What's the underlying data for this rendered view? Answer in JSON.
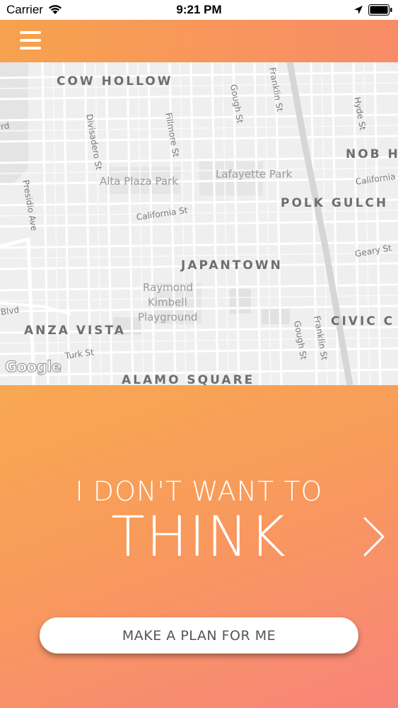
{
  "status_bar": {
    "carrier": "Carrier",
    "time": "9:21 PM"
  },
  "header": {
    "menu_icon": "hamburger-menu-icon"
  },
  "map": {
    "districts": [
      "COW HOLLOW",
      "NOB H",
      "POLK GULCH",
      "JAPANTOWN",
      "ANZA VISTA",
      "CIVIC C",
      "ALAMO SQUARE"
    ],
    "parks": [
      "Alta Plaza Park",
      "Lafayette Park",
      "Raymond",
      "Kimbell",
      "Playground"
    ],
    "streets": [
      "Gough St",
      "Franklin St",
      "Hyde St",
      "Divisadero St",
      "Fillmore St",
      "Presidio Ave",
      "California St",
      "California St",
      "Geary St",
      "Gough St",
      "Franklin St",
      "Turk St",
      "Blvd",
      "rd"
    ],
    "attribution": "Google"
  },
  "panel": {
    "headline_small": "I DON'T WANT TO",
    "headline_big": "THINK",
    "next_icon": "chevron-right-icon",
    "button_label": "MAKE A PLAN FOR ME"
  },
  "colors": {
    "accent_start": "#f7a24e",
    "accent_end": "#f8847a",
    "map_background": "#eeeeef"
  }
}
